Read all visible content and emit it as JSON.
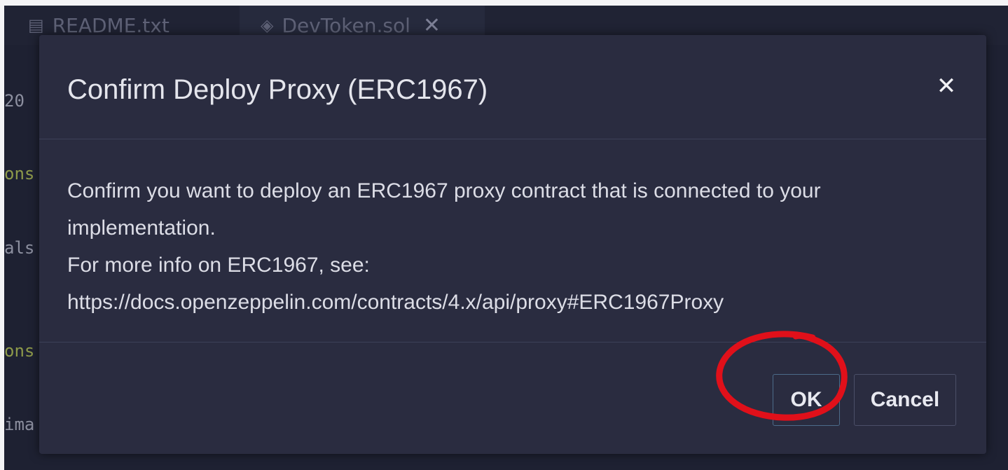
{
  "tabs": [
    {
      "label": "README.txt",
      "icon": "file-text-icon"
    },
    {
      "label": "DevToken.sol",
      "icon": "solidity-file-icon",
      "close": "✕"
    }
  ],
  "code_fragments": [
    "20",
    "ons",
    "als",
    "ons",
    "ima"
  ],
  "dialog": {
    "title": "Confirm Deploy Proxy (ERC1967)",
    "close_symbol": "✕",
    "body_lines": [
      "Confirm you want to deploy an ERC1967 proxy contract that is connected to your",
      "implementation.",
      "For more info on ERC1967, see:",
      "https://docs.openzeppelin.com/contracts/4.x/api/proxy#ERC1967Proxy"
    ],
    "ok_label": "OK",
    "cancel_label": "Cancel"
  },
  "colors": {
    "modal_background": "#2a2c40",
    "annotation": "#e0101a"
  }
}
